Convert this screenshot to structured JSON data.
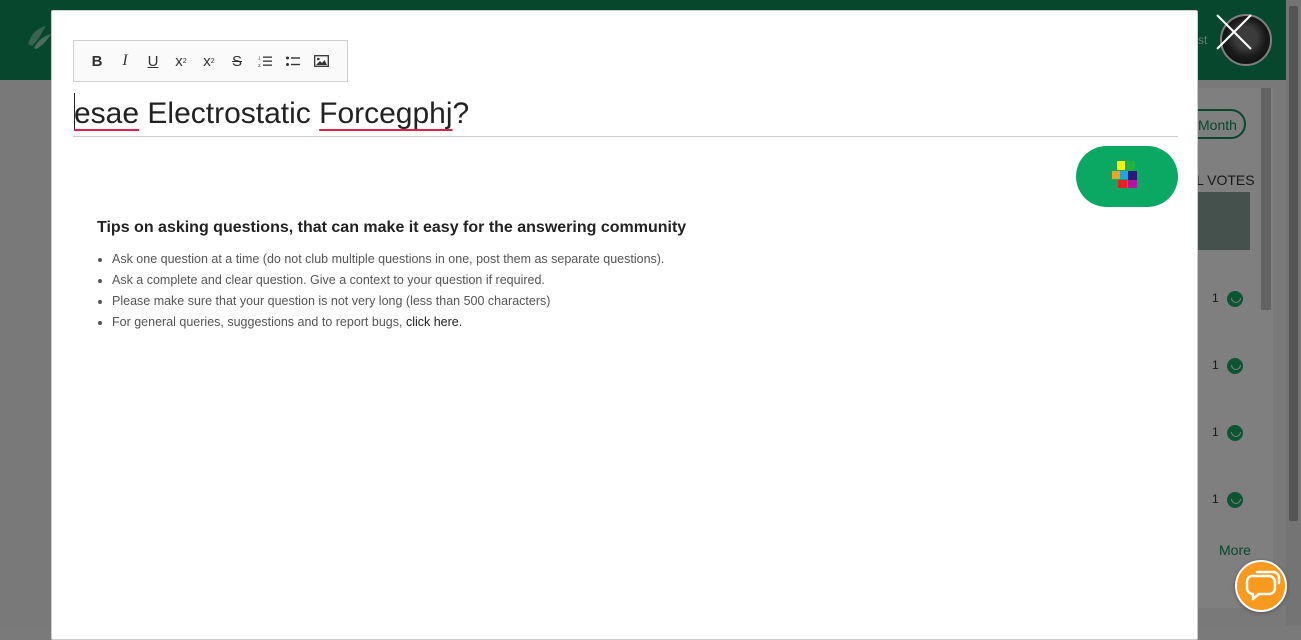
{
  "background": {
    "header_text": "st",
    "period_button": "Month",
    "votes_header": "L VOTES",
    "rows": [
      "1",
      "1",
      "1",
      "1"
    ],
    "more_link": "More"
  },
  "toolbar": {
    "bold": "B",
    "italic": "I",
    "underline": "U",
    "subscript": "x",
    "superscript": "x",
    "strikethrough": "S"
  },
  "question": {
    "word1": "esae",
    "middle": " Electrostatic ",
    "word2": "Forcegphj",
    "tail": "?"
  },
  "tips": {
    "title": "Tips on asking questions, that can make it easy for the answering community",
    "items": [
      "Ask one question at a time (do not club multiple questions in one, post them as separate questions).",
      "Ask a complete and clear question. Give a context to your question if required.",
      "Please make sure that your question is not very long (less than 500 characters)"
    ],
    "last_item_prefix": "For general queries, suggestions and to report bugs, ",
    "last_item_link": "click here."
  },
  "colors": {
    "brand_green": "#0aa862",
    "chat_orange": "#f89a1d",
    "spellcheck_red": "#e0204d"
  },
  "icons": {
    "submit": "colorful-pixel-grid-icon",
    "close": "close-x-icon",
    "chat": "chat-bubbles-icon"
  }
}
